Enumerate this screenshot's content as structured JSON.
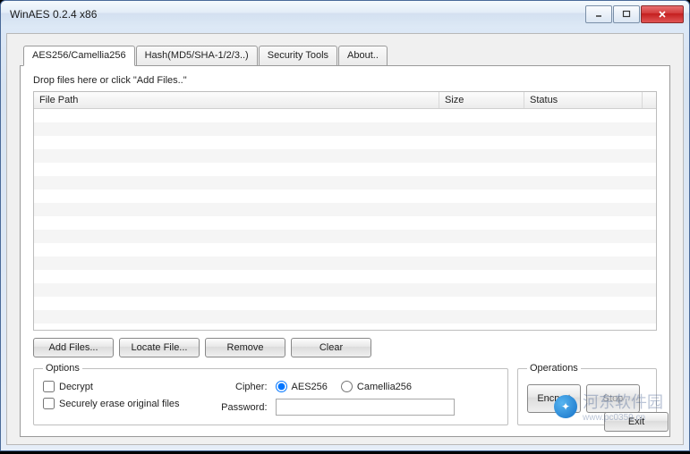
{
  "window": {
    "title": "WinAES 0.2.4 x86"
  },
  "tabs": [
    {
      "label": "AES256/Camellia256"
    },
    {
      "label": "Hash(MD5/SHA-1/2/3..)"
    },
    {
      "label": "Security Tools"
    },
    {
      "label": "About.."
    }
  ],
  "panel": {
    "hint": "Drop files here or click \"Add Files..\"",
    "columns": {
      "filepath": "File Path",
      "size": "Size",
      "status": "Status"
    },
    "buttons": {
      "add": "Add Files...",
      "locate": "Locate File...",
      "remove": "Remove",
      "clear": "Clear"
    }
  },
  "options": {
    "legend": "Options",
    "decrypt": "Decrypt",
    "secure_erase": "Securely erase original files",
    "cipher_label": "Cipher:",
    "cipher_aes": "AES256",
    "cipher_camellia": "Camellia256",
    "password_label": "Password:"
  },
  "operations": {
    "legend": "Operations",
    "encrypt": "Encrypt",
    "stop": "Stop"
  },
  "footer": {
    "exit": "Exit"
  },
  "watermark": {
    "text": "河东软件园",
    "url": "www.pc0359.cn"
  }
}
